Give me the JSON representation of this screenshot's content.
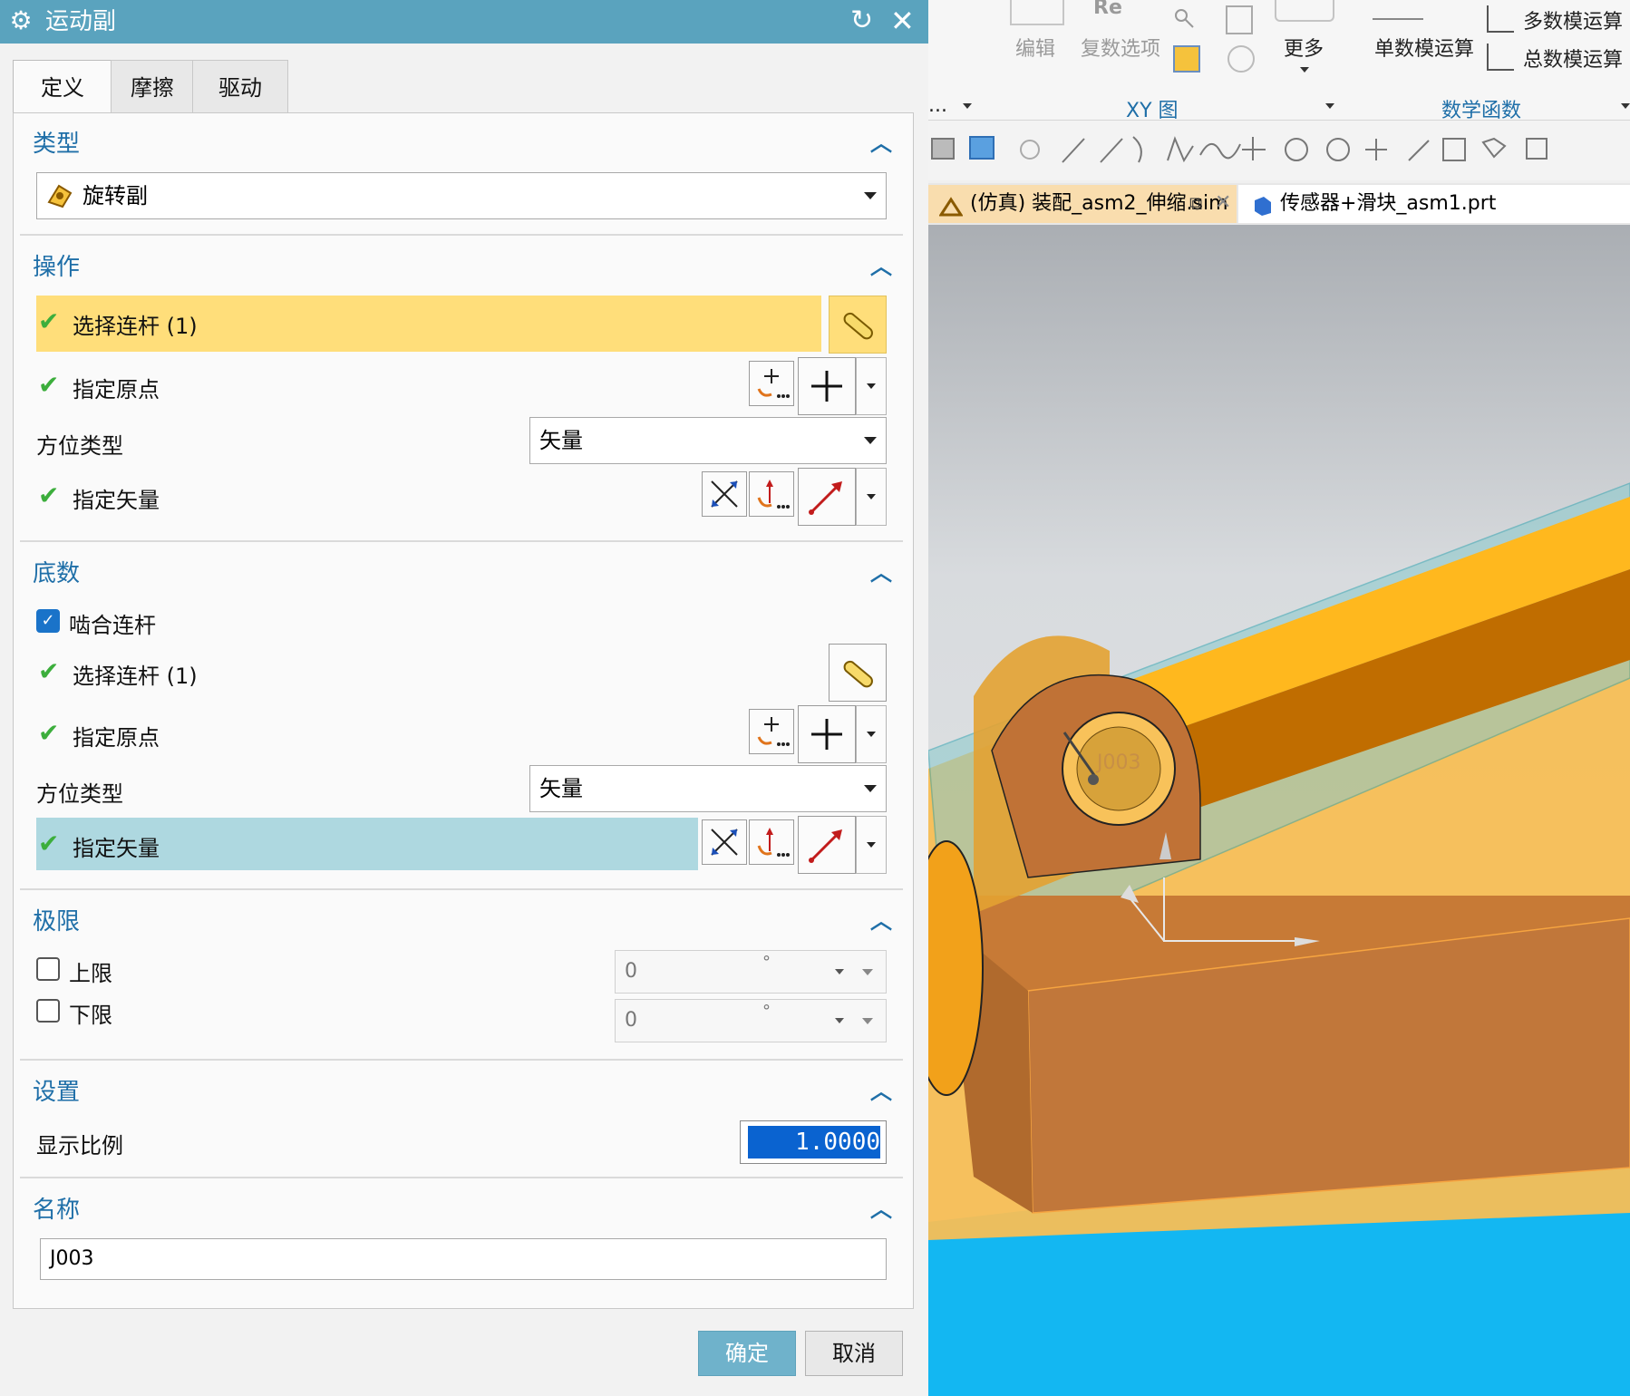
{
  "dialog": {
    "title": "运动副",
    "tabs": [
      "定义",
      "摩擦",
      "驱动"
    ],
    "sections": {
      "type": {
        "title": "类型",
        "value": "旋转副"
      },
      "action": {
        "title": "操作",
        "select_link": "选择连杆 (1)",
        "specify_origin": "指定原点",
        "orient_type_label": "方位类型",
        "orient_type_value": "矢量",
        "specify_vector": "指定矢量"
      },
      "base": {
        "title": "底数",
        "mesh_link": "啮合连杆",
        "select_link": "选择连杆 (1)",
        "specify_origin": "指定原点",
        "orient_type_label": "方位类型",
        "orient_type_value": "矢量",
        "specify_vector": "指定矢量"
      },
      "limits": {
        "title": "极限",
        "upper_label": "上限",
        "upper_value": "0",
        "lower_label": "下限",
        "lower_value": "0",
        "unit": "°"
      },
      "settings": {
        "title": "设置",
        "scale_label": "显示比例",
        "scale_value": "1.0000"
      },
      "name": {
        "title": "名称",
        "value": "J003"
      }
    },
    "ok_label": "确定",
    "cancel_label": "取消"
  },
  "ribbon": {
    "edit_label": "编辑",
    "re_label": "Re",
    "complex_options": "复数选项",
    "more_label": "更多",
    "xy_group": "XY 图",
    "single_op": "单数模运算",
    "multi_op": "多数模运算",
    "total_op": "总数模运算",
    "math_group": "数学函数",
    "left_group_partial": "..."
  },
  "doc_tabs": {
    "active": "(仿真) 装配_asm2_伸缩.sim",
    "other": "传感器+滑块_asm1.prt"
  },
  "viewport": {
    "joint_label": "J003"
  },
  "colors": {
    "title_bar": "#5aa3be",
    "section_title": "#1f6fa8",
    "highlight_yellow": "#ffde7a",
    "highlight_blue": "#aed8e0",
    "check_green": "#3cae3c"
  }
}
